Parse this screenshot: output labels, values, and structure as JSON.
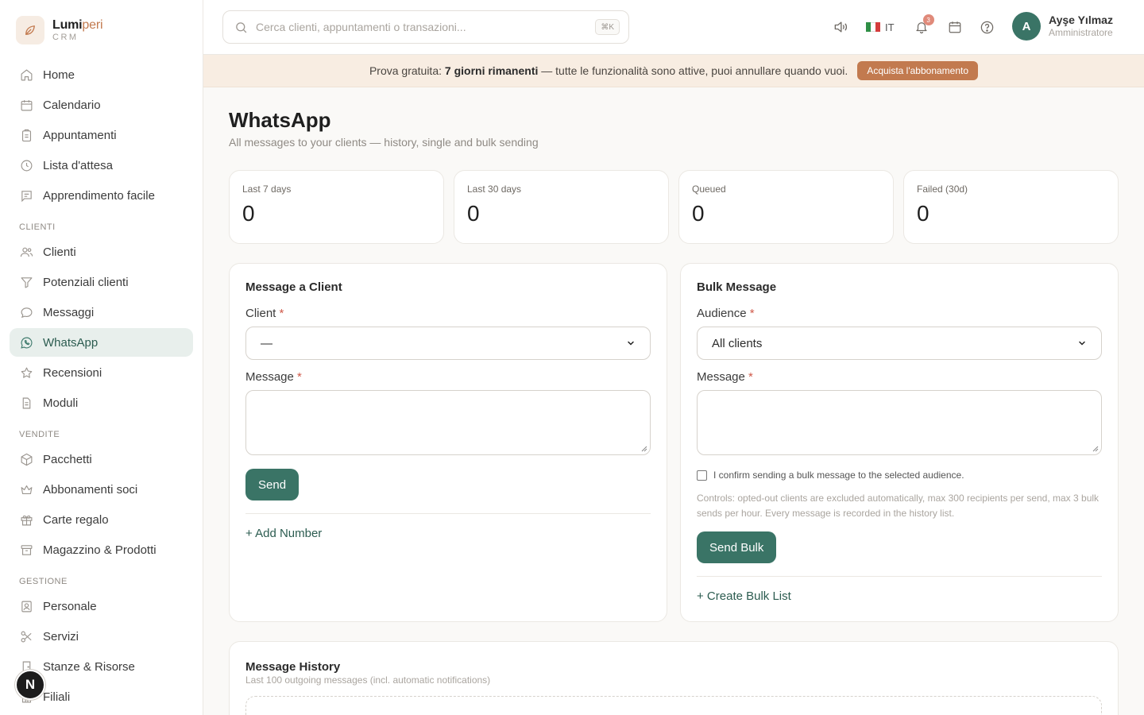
{
  "brand": {
    "name_main": "Lumi",
    "name_accent": "peri",
    "sub": "CRM"
  },
  "sidebar": {
    "items_top": [
      {
        "label": "Home",
        "icon": "home-icon"
      },
      {
        "label": "Calendario",
        "icon": "calendar-icon"
      },
      {
        "label": "Appuntamenti",
        "icon": "clipboard-icon"
      },
      {
        "label": "Lista d'attesa",
        "icon": "clock-icon"
      },
      {
        "label": "Apprendimento facile",
        "icon": "message-square-icon"
      }
    ],
    "section_clients": "CLIENTI",
    "items_clients": [
      {
        "label": "Clienti",
        "icon": "users-icon"
      },
      {
        "label": "Potenziali clienti",
        "icon": "filter-icon"
      },
      {
        "label": "Messaggi",
        "icon": "chat-bubble-icon"
      },
      {
        "label": "WhatsApp",
        "icon": "whatsapp-icon"
      },
      {
        "label": "Recensioni",
        "icon": "star-icon"
      },
      {
        "label": "Moduli",
        "icon": "file-icon"
      }
    ],
    "section_sales": "VENDITE",
    "items_sales": [
      {
        "label": "Pacchetti",
        "icon": "package-icon"
      },
      {
        "label": "Abbonamenti soci",
        "icon": "crown-icon"
      },
      {
        "label": "Carte regalo",
        "icon": "gift-icon"
      },
      {
        "label": "Magazzino & Prodotti",
        "icon": "archive-icon"
      }
    ],
    "section_management": "GESTIONE",
    "items_management": [
      {
        "label": "Personale",
        "icon": "badge-icon"
      },
      {
        "label": "Servizi",
        "icon": "scissors-icon"
      },
      {
        "label": "Stanze & Risorse",
        "icon": "door-icon"
      },
      {
        "label": "Filiali",
        "icon": "building-icon"
      }
    ],
    "active": "WhatsApp",
    "fab_label": "N"
  },
  "topbar": {
    "search_placeholder": "Cerca clienti, appuntamenti o transazioni...",
    "search_shortcut": "⌘K",
    "language": "IT",
    "notifications_count": "3",
    "user_initial": "A",
    "user_name": "Ayşe Yılmaz",
    "user_role": "Amministratore"
  },
  "banner": {
    "prefix": "Prova gratuita:",
    "highlight": "7 giorni rimanenti",
    "suffix": "— tutte le funzionalità sono attive, puoi annullare quando vuoi.",
    "button": "Acquista l'abbonamento"
  },
  "page": {
    "title": "WhatsApp",
    "subtitle": "All messages to your clients — history, single and bulk sending"
  },
  "stats": [
    {
      "label": "Last 7 days",
      "value": "0"
    },
    {
      "label": "Last 30 days",
      "value": "0"
    },
    {
      "label": "Queued",
      "value": "0"
    },
    {
      "label": "Failed (30d)",
      "value": "0"
    }
  ],
  "single": {
    "title": "Message a Client",
    "client_label": "Client",
    "client_value": "—",
    "message_label": "Message",
    "send": "Send",
    "add_number": "+ Add Number"
  },
  "bulk": {
    "title": "Bulk Message",
    "audience_label": "Audience",
    "audience_value": "All clients",
    "message_label": "Message",
    "confirm": "I confirm sending a bulk message to the selected audience.",
    "note": "Controls: opted-out clients are excluded automatically, max 300 recipients per send, max 3 bulk sends per hour. Every message is recorded in the history list.",
    "send": "Send Bulk",
    "create_list": "+ Create Bulk List"
  },
  "history": {
    "title": "Message History",
    "subtitle": "Last 100 outgoing messages (incl. automatic notifications)"
  },
  "colors": {
    "accent": "#3a7466",
    "brand": "#c27a4f",
    "banner_bg": "#f8ede2",
    "active_bg": "#e8efec"
  }
}
